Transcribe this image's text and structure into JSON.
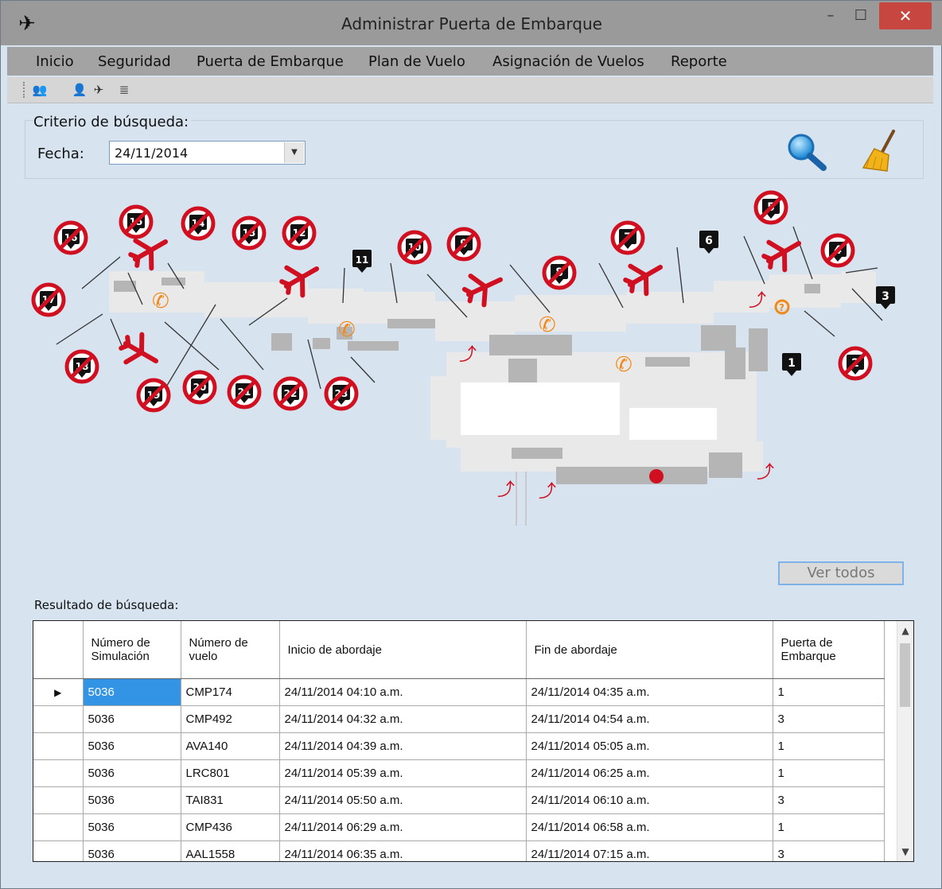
{
  "window": {
    "title": "Administrar Puerta de Embarque",
    "minimize_glyph": "–",
    "maximize_glyph": "☐",
    "close_glyph": "✕",
    "app_icon_glyph": "✈"
  },
  "menu": [
    "Inicio",
    "Seguridad",
    "Puerta de Embarque",
    "Plan de Vuelo",
    "Asignación de Vuelos",
    "Reporte"
  ],
  "toolbar": [
    {
      "icon": "users-icon",
      "glyph": "👥"
    },
    {
      "icon": "user-delete-icon",
      "glyph": "👤"
    },
    {
      "icon": "airplane-gate-icon",
      "glyph": "✈"
    },
    {
      "icon": "report-icon",
      "glyph": "≣"
    }
  ],
  "criteria": {
    "label": "Criterio de búsqueda:",
    "fecha_label": "Fecha:",
    "fecha_value": "24/11/2014"
  },
  "map": {
    "gates": [
      {
        "num": "1",
        "status": "available"
      },
      {
        "num": "2",
        "status": "unavailable"
      },
      {
        "num": "3",
        "status": "available"
      },
      {
        "num": "4",
        "status": "unavailable"
      },
      {
        "num": "5",
        "status": "unavailable"
      },
      {
        "num": "6",
        "status": "available"
      },
      {
        "num": "7",
        "status": "unavailable"
      },
      {
        "num": "8",
        "status": "unavailable"
      },
      {
        "num": "9",
        "status": "unavailable"
      },
      {
        "num": "10",
        "status": "unavailable"
      },
      {
        "num": "11",
        "status": "available"
      },
      {
        "num": "12",
        "status": "unavailable"
      },
      {
        "num": "13",
        "status": "unavailable"
      },
      {
        "num": "14",
        "status": "unavailable"
      },
      {
        "num": "15",
        "status": "unavailable"
      },
      {
        "num": "16",
        "status": "unavailable"
      },
      {
        "num": "17",
        "status": "unavailable"
      },
      {
        "num": "18",
        "status": "unavailable"
      },
      {
        "num": "19",
        "status": "unavailable"
      },
      {
        "num": "20",
        "status": "unavailable"
      },
      {
        "num": "21",
        "status": "unavailable"
      },
      {
        "num": "22",
        "status": "unavailable"
      },
      {
        "num": "23",
        "status": "unavailable"
      }
    ]
  },
  "ver_todos": "Ver todos",
  "results": {
    "label": "Resultado de búsqueda:",
    "columns": [
      "Número de Simulación",
      "Número de vuelo",
      "Inicio de abordaje",
      "Fin de abordaje",
      "Puerta de Embarque"
    ],
    "rows": [
      [
        "5036",
        "CMP174",
        "24/11/2014 04:10 a.m.",
        "24/11/2014 04:35 a.m.",
        "1"
      ],
      [
        "5036",
        "CMP492",
        "24/11/2014 04:32 a.m.",
        "24/11/2014 04:54 a.m.",
        "3"
      ],
      [
        "5036",
        "AVA140",
        "24/11/2014 04:39 a.m.",
        "24/11/2014 05:05 a.m.",
        "1"
      ],
      [
        "5036",
        "LRC801",
        "24/11/2014 05:39 a.m.",
        "24/11/2014 06:25 a.m.",
        "1"
      ],
      [
        "5036",
        "TAI831",
        "24/11/2014 05:50 a.m.",
        "24/11/2014 06:10 a.m.",
        "3"
      ],
      [
        "5036",
        "CMP436",
        "24/11/2014 06:29 a.m.",
        "24/11/2014 06:58 a.m.",
        "1"
      ],
      [
        "5036",
        "AAL1558",
        "24/11/2014 06:35 a.m.",
        "24/11/2014 07:15 a.m.",
        "3"
      ]
    ]
  },
  "colors": {
    "unavailable": "#d01020",
    "available": "#111111",
    "accent": "#3394e6",
    "phone": "#f08a1c",
    "plane": "#d01020"
  }
}
